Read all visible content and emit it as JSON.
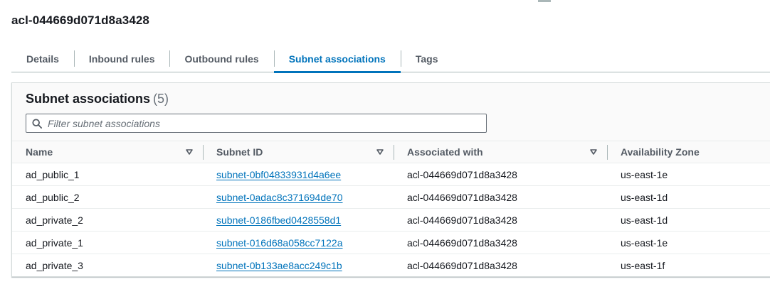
{
  "page": {
    "title": "acl-044669d071d8a3428"
  },
  "tabs": [
    {
      "label": "Details",
      "active": false
    },
    {
      "label": "Inbound rules",
      "active": false
    },
    {
      "label": "Outbound rules",
      "active": false
    },
    {
      "label": "Subnet associations",
      "active": true
    },
    {
      "label": "Tags",
      "active": false
    }
  ],
  "panel": {
    "title": "Subnet associations",
    "count": "(5)",
    "filter_placeholder": "Filter subnet associations",
    "filter_value": ""
  },
  "table": {
    "columns": [
      "Name",
      "Subnet ID",
      "Associated with",
      "Availability Zone"
    ],
    "rows": [
      {
        "name": "ad_public_1",
        "subnet_id": "subnet-0bf04833931d4a6ee",
        "associated_with": "acl-044669d071d8a3428",
        "az": "us-east-1e"
      },
      {
        "name": "ad_public_2",
        "subnet_id": "subnet-0adac8c371694de70",
        "associated_with": "acl-044669d071d8a3428",
        "az": "us-east-1d"
      },
      {
        "name": "ad_private_2",
        "subnet_id": "subnet-0186fbed0428558d1",
        "associated_with": "acl-044669d071d8a3428",
        "az": "us-east-1d"
      },
      {
        "name": "ad_private_1",
        "subnet_id": "subnet-016d68a058cc7122a",
        "associated_with": "acl-044669d071d8a3428",
        "az": "us-east-1e"
      },
      {
        "name": "ad_private_3",
        "subnet_id": "subnet-0b133ae8acc249c1b",
        "associated_with": "acl-044669d071d8a3428",
        "az": "us-east-1f"
      }
    ]
  },
  "icons": {
    "search": "search-icon",
    "sort": "caret-down-icon"
  },
  "colors": {
    "link": "#0073bb",
    "active_tab": "#0073bb",
    "text": "#16191f",
    "muted": "#545b64"
  }
}
